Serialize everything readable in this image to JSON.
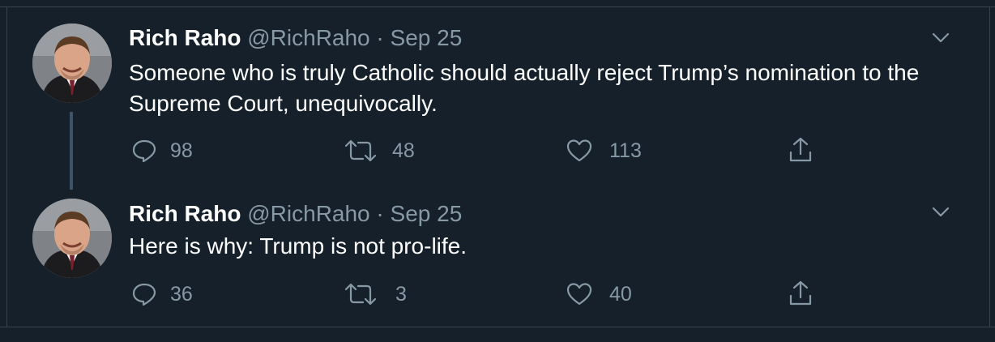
{
  "tweets": [
    {
      "display_name": "Rich Raho",
      "handle": "@RichRaho",
      "separator": "·",
      "date": "Sep 25",
      "text": "Someone who is truly Catholic should actually reject Trump’s nomination to the Supreme Court, unequivocally.",
      "replies": "98",
      "retweets": "48",
      "likes": "113"
    },
    {
      "display_name": "Rich Raho",
      "handle": "@RichRaho",
      "separator": "·",
      "date": "Sep 25",
      "text": "Here is why: Trump is not pro-life.",
      "replies": "36",
      "retweets": "3",
      "likes": "40"
    }
  ],
  "colors": {
    "background": "#15202b",
    "secondary_text": "#8899a6",
    "border": "#38444d",
    "thread_line": "#3d5466"
  },
  "icons": [
    "reply-icon",
    "retweet-icon",
    "like-icon",
    "share-icon",
    "chevron-down-icon"
  ]
}
